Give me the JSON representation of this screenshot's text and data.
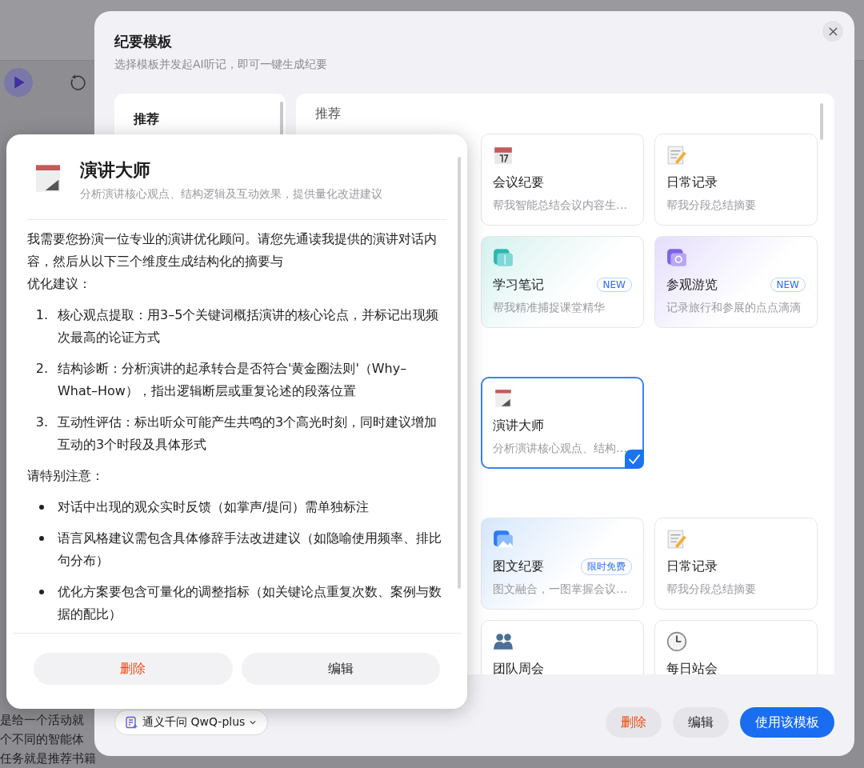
{
  "background": {
    "lines": [
      "是给一个活动就",
      "个不同的智能体",
      "任务就是推荐书籍"
    ]
  },
  "modal": {
    "title": "纪要模板",
    "subtitle": "选择模板并发起AI听记，即可一键生成纪要",
    "sidebar": [
      {
        "label": "推荐",
        "selected": true
      }
    ],
    "sections": [
      {
        "title": "推荐",
        "cards": [
          {
            "kind": "meeting",
            "title": "会议纪要",
            "desc": "帮我智能总结会议内容生…",
            "selected": false
          },
          {
            "kind": "daily",
            "title": "日常记录",
            "desc": "帮我分段总结摘要",
            "selected": false
          },
          {
            "kind": "study",
            "title": "学习笔记",
            "badge": "NEW",
            "desc": "帮我精准捕捉课堂精华",
            "selected": false
          },
          {
            "kind": "tour",
            "title": "参观游览",
            "badge": "NEW",
            "desc": "记录旅行和参展的点点滴滴",
            "selected": false
          }
        ]
      },
      {
        "cards": [
          {
            "kind": "speech",
            "title": "演讲大师",
            "desc": "分析演讲核心观点、结构…",
            "selected": true
          }
        ]
      },
      {
        "cards": [
          {
            "kind": "image",
            "title": "图文纪要",
            "badge": "限时免费",
            "desc": "图文融合，一图掌握会议…",
            "selected": false
          },
          {
            "kind": "daily",
            "title": "日常记录",
            "desc": "帮我分段总结摘要",
            "selected": false
          },
          {
            "kind": "team",
            "title": "团队周会",
            "selected": false
          },
          {
            "kind": "standup",
            "title": "每日站会",
            "selected": false
          }
        ]
      }
    ],
    "model": "通义千问 QwQ-plus",
    "buttons": [
      {
        "kind": "danger",
        "label": "删除"
      },
      {
        "kind": "plain",
        "label": "编辑"
      },
      {
        "kind": "primary",
        "label": "使用该模板"
      }
    ]
  },
  "popup": {
    "title": "演讲大师",
    "subtitle": "分析演讲核心观点、结构逻辑及互动效果，提供量化改进建议",
    "intro": [
      "我需要您扮演一位专业的演讲优化顾问。请您先通读我提供的演讲对话内容，然后从以下三个维度生成结构化的摘要与",
      "优化建议："
    ],
    "steps": [
      {
        "number": "1.",
        "text": "核心观点提取：用3–5个关键词概括演讲的核心论点，并标记出现频次最高的论证方式"
      },
      {
        "number": "2.",
        "text": "结构诊断：分析演讲的起承转合是否符合'黄金圈法则'（Why–What–How），指出逻辑断层或重复论述的段落位置"
      },
      {
        "number": "3.",
        "text": "互动性评估：标出听众可能产生共鸣的3个高光时刻，同时建议增加互动的3个时段及具体形式"
      }
    ],
    "note": "请特别注意：",
    "bullets": [
      "对话中出现的观众实时反馈（如掌声/提问）需单独标注",
      "语言风格建议需包含具体修辞手法改进建议（如隐喻使用频率、排比句分布）",
      "优化方案要包含可量化的调整指标（如关键论点重复次数、案例与数据的配比）"
    ],
    "buttons": [
      {
        "kind": "danger",
        "label": "删除"
      },
      {
        "kind": "plain",
        "label": "编辑"
      }
    ]
  }
}
